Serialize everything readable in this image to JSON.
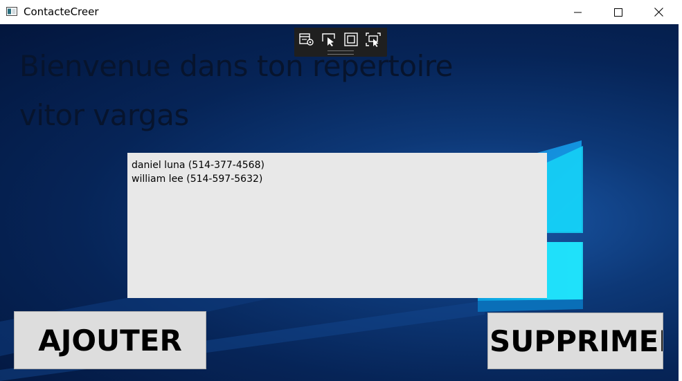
{
  "window": {
    "title": "ContacteCreer",
    "icon": "app-window-icon",
    "controls": [
      "minimize-icon",
      "maximize-icon",
      "close-icon"
    ]
  },
  "debug_toolbar": {
    "icons": [
      "live-visual-tree-icon",
      "select-element-icon",
      "display-layout-adorners-icon",
      "track-focused-element-icon"
    ]
  },
  "header": {
    "welcome_text": "Bienvenue dans ton repertoire",
    "user_name": "vitor vargas"
  },
  "contacts": {
    "items": [
      "daniel luna (514-377-4568)",
      "william lee (514-597-5632)"
    ]
  },
  "buttons": {
    "add_label": "AJOUTER",
    "delete_label": "SUPPRIMER"
  },
  "colors": {
    "background": "#0b2a5c",
    "listbox": "#e8e8e8",
    "button": "#dddddd",
    "text_dark": "#07142d"
  }
}
